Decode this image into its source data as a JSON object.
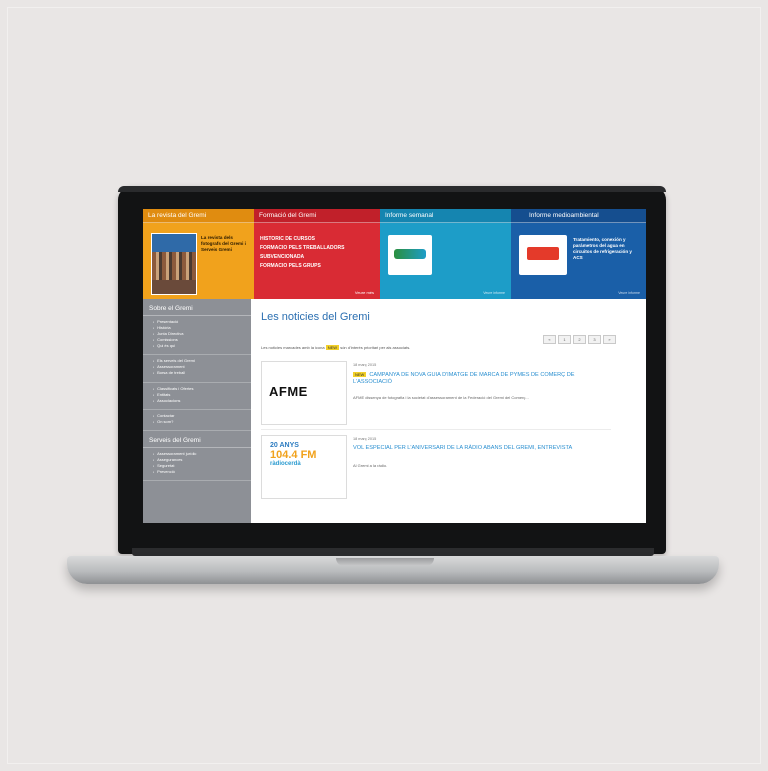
{
  "banner": {
    "panel1": {
      "title": "La revista del Gremi",
      "text": "La revista dels fotografs del Gremi i Serveis Gremi"
    },
    "panel2": {
      "title": "Formació del Gremi",
      "items": [
        "HISTORIC DE CURSOS",
        "FORMACIO PELS TREBALLADORS",
        "SUBVENCIONADA",
        "FORMACIO PELS GRUPS"
      ],
      "more": "Veure més"
    },
    "panel3": {
      "title": "Informe semanal",
      "small": "Veure informe"
    },
    "panel4": {
      "title": "Informe medioambiental",
      "text": "Tratamiento, conexión y parámetros del agua en circuitos de refrigeración y ACS",
      "small": "Veure informe"
    }
  },
  "sidebar": {
    "section1": "Sobre el Gremi",
    "group1": [
      "Presentació",
      "Història",
      "Junta Directiva",
      "Comissions",
      "Qui és qui"
    ],
    "group2": [
      "Els serveis del Gremi",
      "Assessorament",
      "Borsa de treball"
    ],
    "group3": [
      "Classificats i Ofertes",
      "Entitats",
      "Associacions"
    ],
    "group4": [
      "Contactar",
      "On som?"
    ],
    "section2": "Serveis del Gremi",
    "group5": [
      "Assessorament jurídic",
      "Assegurances",
      "Seguretat",
      "Prevenció"
    ]
  },
  "main": {
    "title": "Les noticies del Gremi",
    "intro_before": "Les noticies marcades amb la icona",
    "intro_badge": "NEW",
    "intro_after": "són d'interès prioritari per als associats.",
    "pager": [
      "«",
      "1",
      "2",
      "3",
      "»"
    ],
    "news": [
      {
        "date": "18 març 2015",
        "badge": "NEW",
        "headline": "CAMPANYA DE NOVA GUIA D'IMATGE DE MARCA DE PYMES DE COMERÇ DE L'ASSOCIACIÓ",
        "body": "AFME dissenya de fotografia i la societat d'assessorament de la Federació del Gremi del Comerç...",
        "thumb": "AFME"
      },
      {
        "date": "18 març 2015",
        "headline": "VOL ESPECIAL PER L'ANIVERSARI DE LA RÀDIO ABANS DEL GREMI, ENTREVISTA",
        "body": "Al Gremi a la ràdio.",
        "thumb_years": "20 ANYS",
        "thumb_freq": "104.4 FM",
        "thumb_station": "ràdiocerdà"
      }
    ]
  }
}
